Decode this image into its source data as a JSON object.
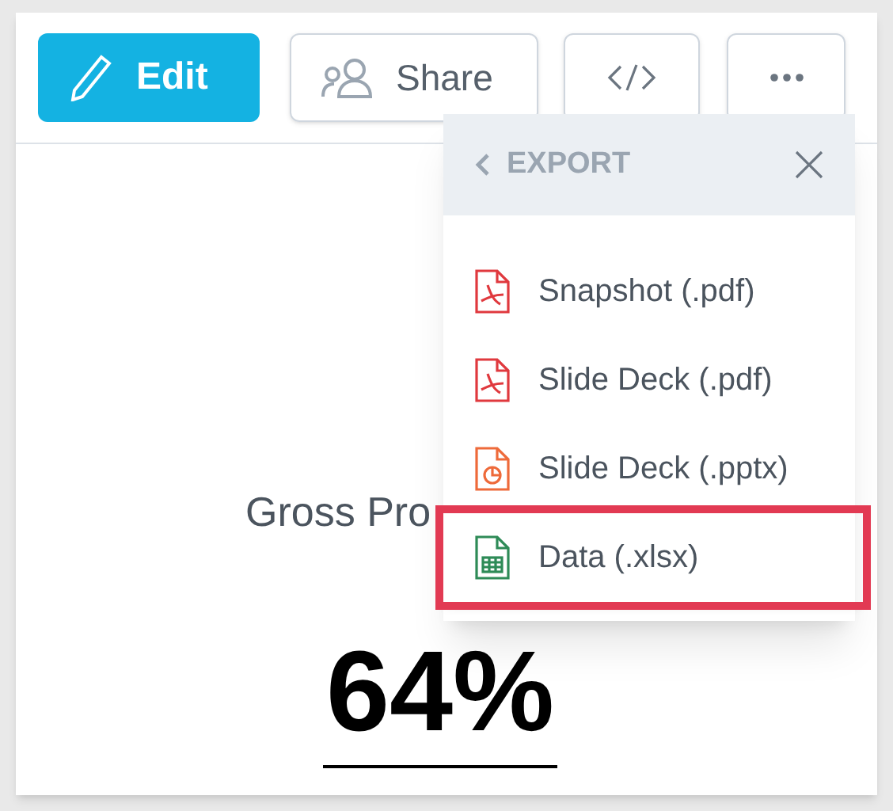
{
  "toolbar": {
    "edit": "Edit",
    "share": "Share"
  },
  "export_menu": {
    "title": "EXPORT",
    "items": [
      {
        "label": "Snapshot (.pdf)",
        "kind": "pdf",
        "highlighted": false
      },
      {
        "label": "Slide Deck (.pdf)",
        "kind": "pdf",
        "highlighted": false
      },
      {
        "label": "Slide Deck (.pptx)",
        "kind": "pptx",
        "highlighted": false
      },
      {
        "label": "Data (.xlsx)",
        "kind": "xlsx",
        "highlighted": true
      }
    ]
  },
  "kpi": {
    "title": "Gross Pro",
    "value": "64%"
  }
}
